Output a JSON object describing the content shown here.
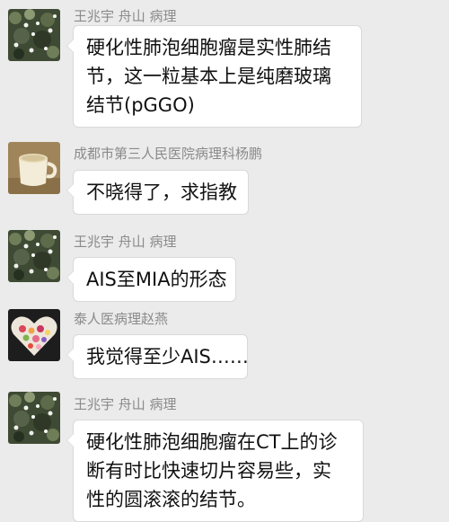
{
  "messages": [
    {
      "sender": "王兆宇  舟山  病理",
      "avatar": "flower-bush-avatar",
      "lines": [
        "硬化性肺泡细胞瘤是实性肺结",
        "节，这一粒基本上是纯磨玻璃",
        "结节(pGGO)"
      ]
    },
    {
      "sender": "成都市第三人民医院病理科杨鹏",
      "avatar": "coffee-cup-avatar",
      "lines": [
        "不晓得了，求指教"
      ]
    },
    {
      "sender": "王兆宇  舟山  病理",
      "avatar": "flower-bush-avatar",
      "lines": [
        "AIS至MIA的形态"
      ]
    },
    {
      "sender": "泰人医病理赵燕",
      "avatar": "heart-flowers-avatar",
      "lines": [
        "我觉得至少AIS……"
      ]
    },
    {
      "sender": "王兆宇  舟山  病理",
      "avatar": "flower-bush-avatar",
      "lines": [
        "硬化性肺泡细胞瘤在CT上的诊",
        "断有时比快速切片容易些，实",
        "性的圆滚滚的结节。"
      ]
    }
  ]
}
